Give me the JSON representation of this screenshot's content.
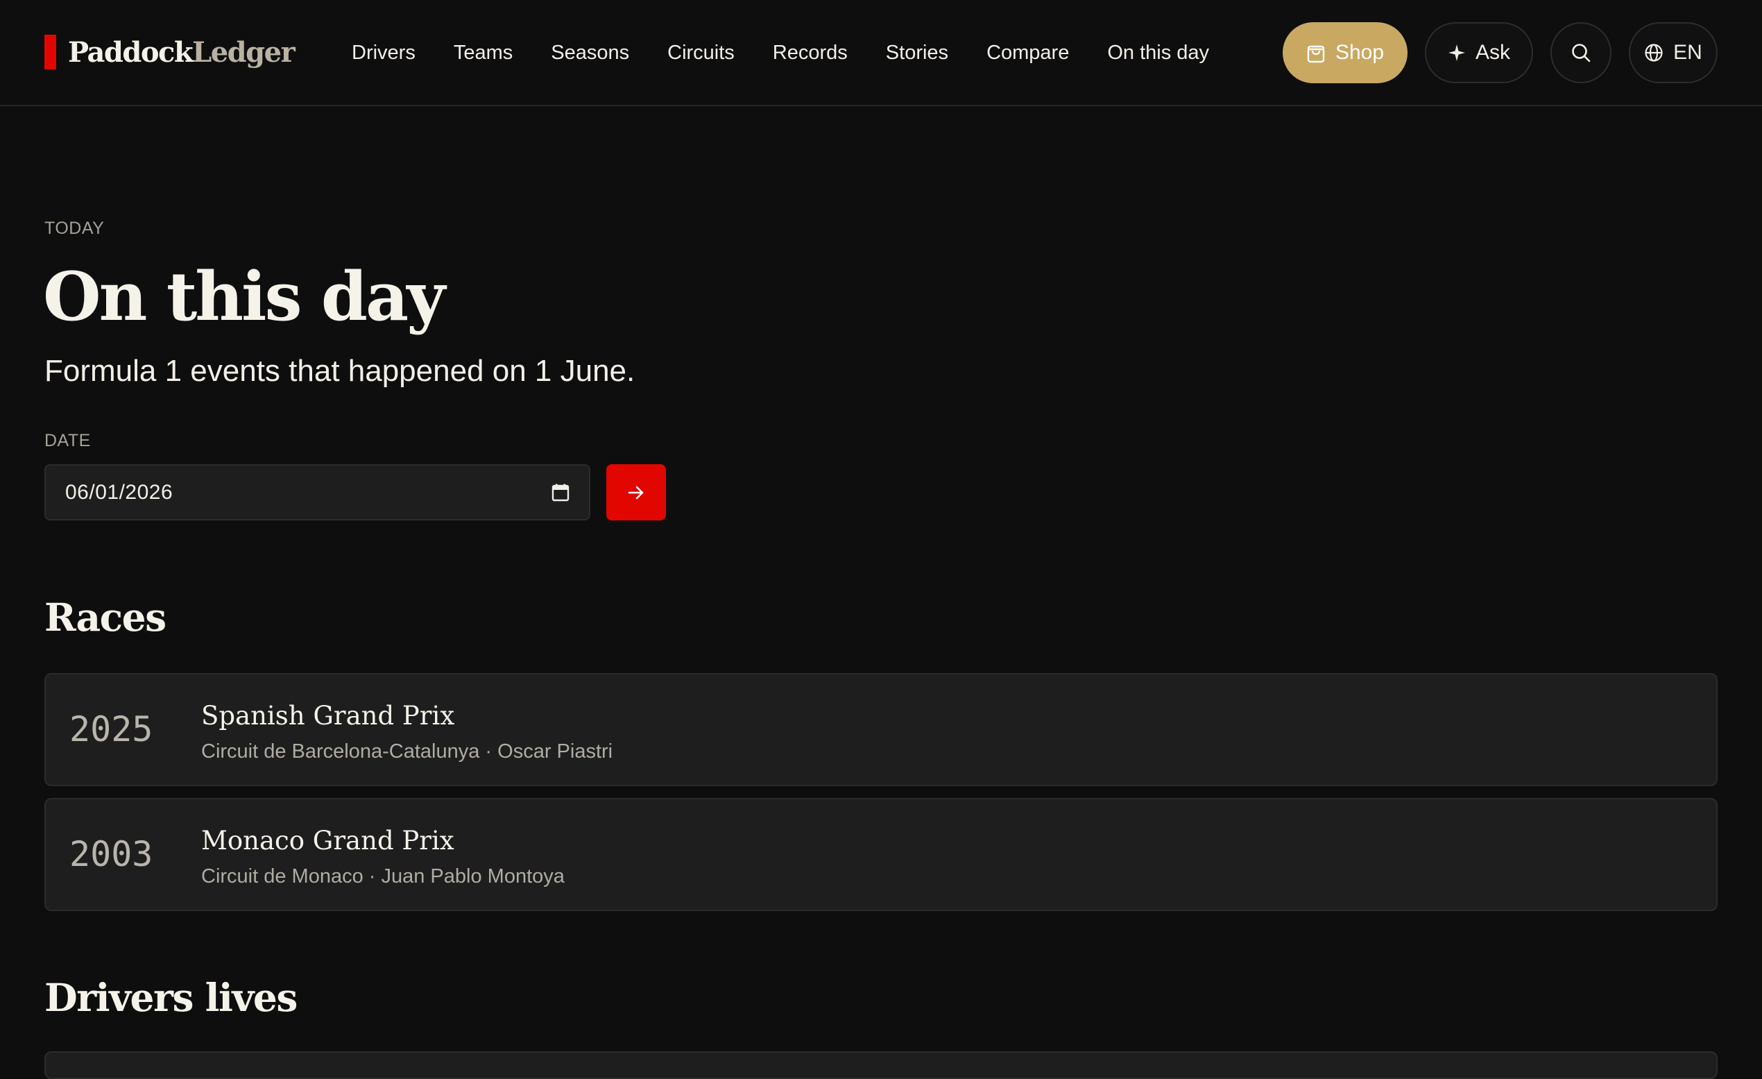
{
  "brand": {
    "name_primary": "Paddock",
    "name_accent": "Ledger"
  },
  "nav": {
    "items": [
      {
        "label": "Drivers"
      },
      {
        "label": "Teams"
      },
      {
        "label": "Seasons"
      },
      {
        "label": "Circuits"
      },
      {
        "label": "Records"
      },
      {
        "label": "Stories"
      },
      {
        "label": "Compare"
      },
      {
        "label": "On this day"
      }
    ]
  },
  "actions": {
    "shop_label": "Shop",
    "ask_label": "Ask",
    "lang_label": "EN",
    "icons": [
      "shopping-bag-icon",
      "sparkle-icon",
      "search-icon",
      "globe-icon"
    ]
  },
  "hero": {
    "eyebrow": "TODAY",
    "title": "On this day",
    "subtitle": "Formula 1 events that happened on 1 June."
  },
  "date_picker": {
    "label": "DATE",
    "value": "06/01/2026"
  },
  "races": {
    "heading": "Races",
    "items": [
      {
        "year": "2025",
        "name": "Spanish Grand Prix",
        "meta": "Circuit de Barcelona-Catalunya · Oscar Piastri"
      },
      {
        "year": "2003",
        "name": "Monaco Grand Prix",
        "meta": "Circuit de Monaco · Juan Pablo Montoya"
      }
    ]
  },
  "drivers_lives": {
    "heading": "Drivers lives"
  },
  "colors": {
    "background": "#0e0e0e",
    "accent_red": "#e10600",
    "shop_gold": "#c9a862",
    "card": "#1e1e1e"
  }
}
